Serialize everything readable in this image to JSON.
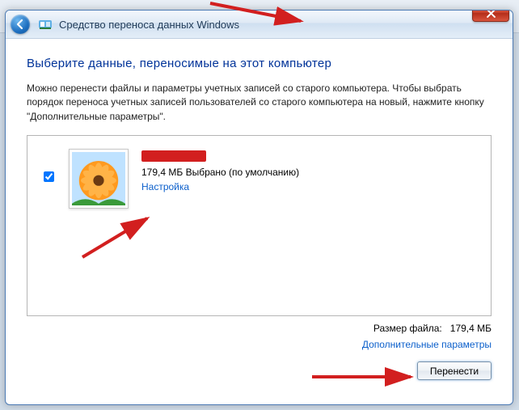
{
  "window": {
    "title": "Средство переноса данных Windows"
  },
  "page": {
    "heading": "Выберите данные, переносимые на этот компьютер",
    "instructions": "Можно перенести файлы и параметры учетных записей со старого компьютера. Чтобы выбрать порядок переноса учетных записей пользователей со старого компьютера на новый, нажмите кнопку \"Дополнительные параметры\"."
  },
  "account": {
    "selected_size_line": "179,4 МБ Выбрано (по умолчанию)",
    "customize_link": "Настройка"
  },
  "footer": {
    "file_size_label": "Размер файла:",
    "file_size_value": "179,4 МБ",
    "advanced_link": "Дополнительные параметры"
  },
  "buttons": {
    "transfer": "Перенести"
  }
}
